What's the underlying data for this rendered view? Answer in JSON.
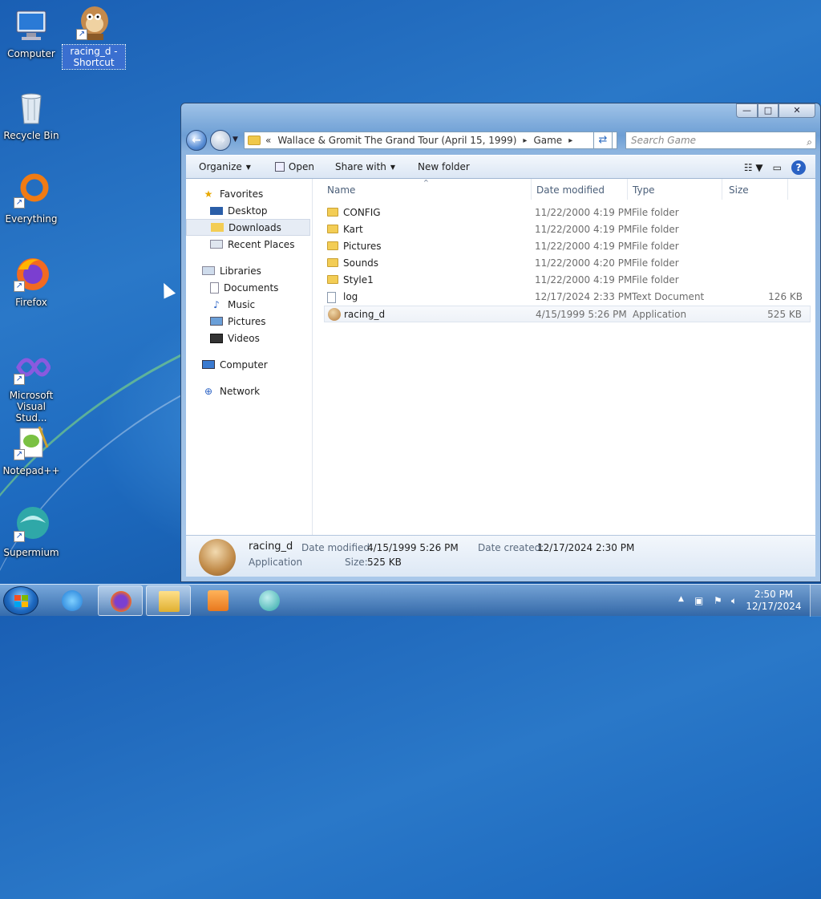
{
  "desktop": {
    "icons": [
      {
        "label": "Computer",
        "icon": "computer-icon"
      },
      {
        "label": "racing_d - Shortcut",
        "icon": "wallace-app-icon",
        "selected": true
      },
      {
        "label": "Recycle Bin",
        "icon": "recycle-bin-icon"
      },
      {
        "label": "Everything",
        "icon": "everything-icon"
      },
      {
        "label": "Firefox",
        "icon": "firefox-icon"
      },
      {
        "label": "Microsoft Visual Stud...",
        "icon": "visual-studio-icon"
      },
      {
        "label": "Notepad++",
        "icon": "notepadpp-icon"
      },
      {
        "label": "Supermium",
        "icon": "supermium-icon"
      }
    ]
  },
  "window": {
    "controls": {
      "minimize": "—",
      "maximize": "□",
      "close": "✕"
    },
    "address": {
      "chevron": "«",
      "crumbs": [
        "Wallace & Gromit The Grand Tour (April 15, 1999)",
        "Game"
      ],
      "sep": "▸"
    },
    "search_placeholder": "Search Game",
    "toolbar": {
      "organize": "Organize",
      "open": "Open",
      "share_with": "Share with",
      "new_folder": "New folder"
    },
    "nav": {
      "favorites": "Favorites",
      "favorites_items": [
        "Desktop",
        "Downloads",
        "Recent Places"
      ],
      "libraries": "Libraries",
      "libraries_items": [
        "Documents",
        "Music",
        "Pictures",
        "Videos"
      ],
      "computer": "Computer",
      "network": "Network"
    },
    "columns": {
      "name": "Name",
      "date": "Date modified",
      "type": "Type",
      "size": "Size"
    },
    "files": [
      {
        "name": "CONFIG",
        "date": "11/22/2000 4:19 PM",
        "type": "File folder",
        "size": "",
        "kind": "folder"
      },
      {
        "name": "Kart",
        "date": "11/22/2000 4:19 PM",
        "type": "File folder",
        "size": "",
        "kind": "folder"
      },
      {
        "name": "Pictures",
        "date": "11/22/2000 4:19 PM",
        "type": "File folder",
        "size": "",
        "kind": "folder"
      },
      {
        "name": "Sounds",
        "date": "11/22/2000 4:20 PM",
        "type": "File folder",
        "size": "",
        "kind": "folder"
      },
      {
        "name": "Style1",
        "date": "11/22/2000 4:19 PM",
        "type": "File folder",
        "size": "",
        "kind": "folder"
      },
      {
        "name": "log",
        "date": "12/17/2024 2:33 PM",
        "type": "Text Document",
        "size": "126 KB",
        "kind": "doc"
      },
      {
        "name": "racing_d",
        "date": "4/15/1999 5:26 PM",
        "type": "Application",
        "size": "525 KB",
        "kind": "app"
      }
    ],
    "details": {
      "name": "racing_d",
      "type": "Application",
      "date_modified_label": "Date modified:",
      "date_modified": "4/15/1999 5:26 PM",
      "date_created_label": "Date created:",
      "date_created": "12/17/2024 2:30 PM",
      "size_label": "Size:",
      "size": "525 KB"
    }
  },
  "taskbar": {
    "pinned": [
      "ie-icon",
      "firefox-icon",
      "explorer-icon",
      "media-player-icon",
      "supermium-icon"
    ],
    "clock": {
      "time": "2:50 PM",
      "date": "12/17/2024"
    }
  }
}
